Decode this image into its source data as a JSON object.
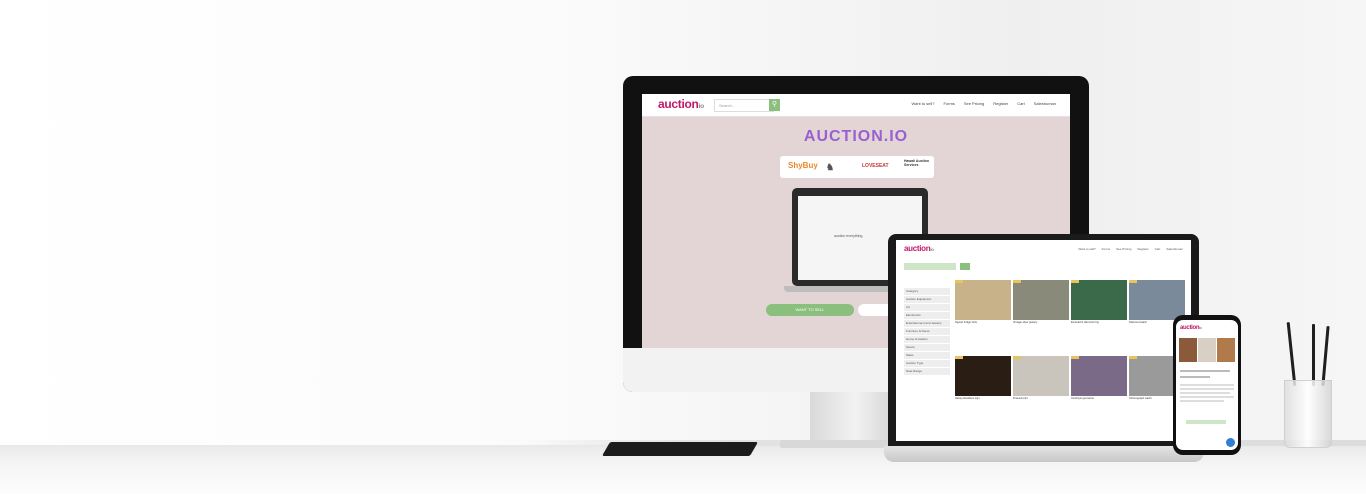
{
  "monitor": {
    "nav": {
      "logo": "auction",
      "logo_suffix": "io",
      "search_placeholder": "Search...",
      "links": [
        "Want to sell?",
        "Forms",
        "See Pricing",
        "Register",
        "Cart",
        "Saleshuman"
      ]
    },
    "hero_title": "AUCTION.IO",
    "brands": [
      "ShyBuy",
      "LOVESEAT",
      "Hawaii Auction Services"
    ],
    "inner_select": "auction everything",
    "cta_primary": "WANT TO SELL"
  },
  "laptop": {
    "nav": {
      "logo": "auction",
      "logo_suffix": "io",
      "links": [
        "Want to sell?",
        "Forms",
        "See Pricing",
        "Register",
        "Cart",
        "Saleshuman"
      ]
    },
    "sidebar": [
      "Category",
      "Auction Equipment",
      "Art",
      "Electronics",
      "Entertainment and Jewelry",
      "Furniture & Decor",
      "Home & Garden",
      "Sports",
      "Sales",
      "Auction Type",
      "Date Range"
    ],
    "cards": [
      {
        "title": "Signed Indigo Girls",
        "badge": "#e8c45a",
        "img": "#c8b28a"
      },
      {
        "title": "Vintage silver jewelry",
        "badge": "#e8c45a",
        "img": "#8a8a7a"
      },
      {
        "title": "Emerald & diamond ring",
        "badge": "#e8c45a",
        "img": "#3a6a4a"
      },
      {
        "title": "Diamond watch",
        "badge": "#e8c45a",
        "img": "#7a8a9a"
      },
      {
        "title": "Harley-Davidson sign",
        "badge": "#e8c45a",
        "img": "#2a1d14"
      },
      {
        "title": "Framed print",
        "badge": "#e8c45a",
        "img": "#c9c4bc"
      },
      {
        "title": "Amethyst gemstone",
        "badge": "#e8c45a",
        "img": "#7a6a88"
      },
      {
        "title": "Chronograph watch",
        "badge": "#e8c45a",
        "img": "#9a9a9a"
      }
    ]
  },
  "phone": {
    "logo": "auction",
    "logo_suffix": "io"
  },
  "colors": {
    "brand_pink": "#c2186b",
    "brand_green": "#8bbf7e",
    "hero_purple": "#9a5fd0"
  }
}
